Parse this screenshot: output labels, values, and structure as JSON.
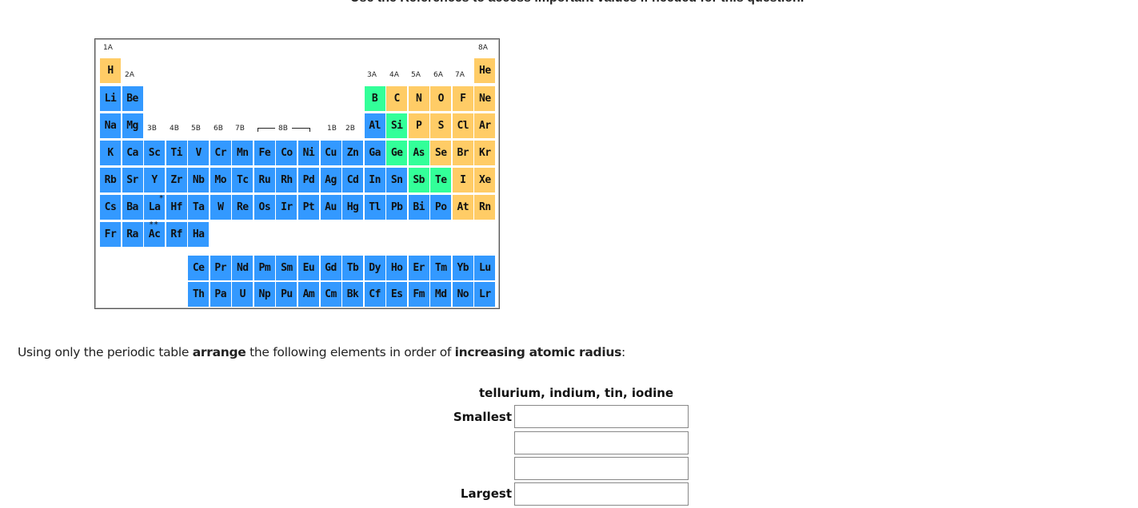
{
  "header": {
    "note": "Use the References to access important values if needed for this question."
  },
  "periodic_table": {
    "legend_colors": {
      "metal": "#3399ff",
      "nonmetal": "#ffcc66",
      "metalloid": "#33ff99"
    },
    "group_labels": {
      "g1": "1A",
      "g2": "2A",
      "g3": "3B",
      "g4": "4B",
      "g5": "5B",
      "g6": "6B",
      "g7": "7B",
      "g8": "8B",
      "g11": "1B",
      "g12": "2B",
      "g13": "3A",
      "g14": "4A",
      "g15": "5A",
      "g16": "6A",
      "g17": "7A",
      "g18": "8A"
    },
    "elements": [
      {
        "symbol": "H",
        "row": 1,
        "col": 1,
        "type": "nonmetal"
      },
      {
        "symbol": "He",
        "row": 1,
        "col": 18,
        "type": "nonmetal"
      },
      {
        "symbol": "Li",
        "row": 2,
        "col": 1,
        "type": "metal"
      },
      {
        "symbol": "Be",
        "row": 2,
        "col": 2,
        "type": "metal"
      },
      {
        "symbol": "B",
        "row": 2,
        "col": 13,
        "type": "metalloid"
      },
      {
        "symbol": "C",
        "row": 2,
        "col": 14,
        "type": "nonmetal"
      },
      {
        "symbol": "N",
        "row": 2,
        "col": 15,
        "type": "nonmetal"
      },
      {
        "symbol": "O",
        "row": 2,
        "col": 16,
        "type": "nonmetal"
      },
      {
        "symbol": "F",
        "row": 2,
        "col": 17,
        "type": "nonmetal"
      },
      {
        "symbol": "Ne",
        "row": 2,
        "col": 18,
        "type": "nonmetal"
      },
      {
        "symbol": "Na",
        "row": 3,
        "col": 1,
        "type": "metal"
      },
      {
        "symbol": "Mg",
        "row": 3,
        "col": 2,
        "type": "metal"
      },
      {
        "symbol": "Al",
        "row": 3,
        "col": 13,
        "type": "metal"
      },
      {
        "symbol": "Si",
        "row": 3,
        "col": 14,
        "type": "metalloid"
      },
      {
        "symbol": "P",
        "row": 3,
        "col": 15,
        "type": "nonmetal"
      },
      {
        "symbol": "S",
        "row": 3,
        "col": 16,
        "type": "nonmetal"
      },
      {
        "symbol": "Cl",
        "row": 3,
        "col": 17,
        "type": "nonmetal"
      },
      {
        "symbol": "Ar",
        "row": 3,
        "col": 18,
        "type": "nonmetal"
      },
      {
        "symbol": "K",
        "row": 4,
        "col": 1,
        "type": "metal"
      },
      {
        "symbol": "Ca",
        "row": 4,
        "col": 2,
        "type": "metal"
      },
      {
        "symbol": "Sc",
        "row": 4,
        "col": 3,
        "type": "metal"
      },
      {
        "symbol": "Ti",
        "row": 4,
        "col": 4,
        "type": "metal"
      },
      {
        "symbol": "V",
        "row": 4,
        "col": 5,
        "type": "metal"
      },
      {
        "symbol": "Cr",
        "row": 4,
        "col": 6,
        "type": "metal"
      },
      {
        "symbol": "Mn",
        "row": 4,
        "col": 7,
        "type": "metal"
      },
      {
        "symbol": "Fe",
        "row": 4,
        "col": 8,
        "type": "metal"
      },
      {
        "symbol": "Co",
        "row": 4,
        "col": 9,
        "type": "metal"
      },
      {
        "symbol": "Ni",
        "row": 4,
        "col": 10,
        "type": "metal"
      },
      {
        "symbol": "Cu",
        "row": 4,
        "col": 11,
        "type": "metal"
      },
      {
        "symbol": "Zn",
        "row": 4,
        "col": 12,
        "type": "metal"
      },
      {
        "symbol": "Ga",
        "row": 4,
        "col": 13,
        "type": "metal"
      },
      {
        "symbol": "Ge",
        "row": 4,
        "col": 14,
        "type": "metalloid"
      },
      {
        "symbol": "As",
        "row": 4,
        "col": 15,
        "type": "metalloid"
      },
      {
        "symbol": "Se",
        "row": 4,
        "col": 16,
        "type": "nonmetal"
      },
      {
        "symbol": "Br",
        "row": 4,
        "col": 17,
        "type": "nonmetal"
      },
      {
        "symbol": "Kr",
        "row": 4,
        "col": 18,
        "type": "nonmetal"
      },
      {
        "symbol": "Rb",
        "row": 5,
        "col": 1,
        "type": "metal"
      },
      {
        "symbol": "Sr",
        "row": 5,
        "col": 2,
        "type": "metal"
      },
      {
        "symbol": "Y",
        "row": 5,
        "col": 3,
        "type": "metal"
      },
      {
        "symbol": "Zr",
        "row": 5,
        "col": 4,
        "type": "metal"
      },
      {
        "symbol": "Nb",
        "row": 5,
        "col": 5,
        "type": "metal"
      },
      {
        "symbol": "Mo",
        "row": 5,
        "col": 6,
        "type": "metal"
      },
      {
        "symbol": "Tc",
        "row": 5,
        "col": 7,
        "type": "metal"
      },
      {
        "symbol": "Ru",
        "row": 5,
        "col": 8,
        "type": "metal"
      },
      {
        "symbol": "Rh",
        "row": 5,
        "col": 9,
        "type": "metal"
      },
      {
        "symbol": "Pd",
        "row": 5,
        "col": 10,
        "type": "metal"
      },
      {
        "symbol": "Ag",
        "row": 5,
        "col": 11,
        "type": "metal"
      },
      {
        "symbol": "Cd",
        "row": 5,
        "col": 12,
        "type": "metal"
      },
      {
        "symbol": "In",
        "row": 5,
        "col": 13,
        "type": "metal"
      },
      {
        "symbol": "Sn",
        "row": 5,
        "col": 14,
        "type": "metal"
      },
      {
        "symbol": "Sb",
        "row": 5,
        "col": 15,
        "type": "metalloid"
      },
      {
        "symbol": "Te",
        "row": 5,
        "col": 16,
        "type": "metalloid"
      },
      {
        "symbol": "I",
        "row": 5,
        "col": 17,
        "type": "nonmetal"
      },
      {
        "symbol": "Xe",
        "row": 5,
        "col": 18,
        "type": "nonmetal"
      },
      {
        "symbol": "Cs",
        "row": 6,
        "col": 1,
        "type": "metal"
      },
      {
        "symbol": "Ba",
        "row": 6,
        "col": 2,
        "type": "metal"
      },
      {
        "symbol": "La",
        "row": 6,
        "col": 3,
        "type": "metal",
        "mark": "*"
      },
      {
        "symbol": "Hf",
        "row": 6,
        "col": 4,
        "type": "metal"
      },
      {
        "symbol": "Ta",
        "row": 6,
        "col": 5,
        "type": "metal"
      },
      {
        "symbol": "W",
        "row": 6,
        "col": 6,
        "type": "metal"
      },
      {
        "symbol": "Re",
        "row": 6,
        "col": 7,
        "type": "metal"
      },
      {
        "symbol": "Os",
        "row": 6,
        "col": 8,
        "type": "metal"
      },
      {
        "symbol": "Ir",
        "row": 6,
        "col": 9,
        "type": "metal"
      },
      {
        "symbol": "Pt",
        "row": 6,
        "col": 10,
        "type": "metal"
      },
      {
        "symbol": "Au",
        "row": 6,
        "col": 11,
        "type": "metal"
      },
      {
        "symbol": "Hg",
        "row": 6,
        "col": 12,
        "type": "metal"
      },
      {
        "symbol": "Tl",
        "row": 6,
        "col": 13,
        "type": "metal"
      },
      {
        "symbol": "Pb",
        "row": 6,
        "col": 14,
        "type": "metal"
      },
      {
        "symbol": "Bi",
        "row": 6,
        "col": 15,
        "type": "metal"
      },
      {
        "symbol": "Po",
        "row": 6,
        "col": 16,
        "type": "metal"
      },
      {
        "symbol": "At",
        "row": 6,
        "col": 17,
        "type": "nonmetal"
      },
      {
        "symbol": "Rn",
        "row": 6,
        "col": 18,
        "type": "nonmetal"
      },
      {
        "symbol": "Fr",
        "row": 7,
        "col": 1,
        "type": "metal"
      },
      {
        "symbol": "Ra",
        "row": 7,
        "col": 2,
        "type": "metal"
      },
      {
        "symbol": "Ac",
        "row": 7,
        "col": 3,
        "type": "metal",
        "mark": "**"
      },
      {
        "symbol": "Rf",
        "row": 7,
        "col": 4,
        "type": "metal"
      },
      {
        "symbol": "Ha",
        "row": 7,
        "col": 5,
        "type": "metal"
      },
      {
        "symbol": "Ce",
        "row": 8,
        "col": 5,
        "type": "metal"
      },
      {
        "symbol": "Pr",
        "row": 8,
        "col": 6,
        "type": "metal"
      },
      {
        "symbol": "Nd",
        "row": 8,
        "col": 7,
        "type": "metal"
      },
      {
        "symbol": "Pm",
        "row": 8,
        "col": 8,
        "type": "metal"
      },
      {
        "symbol": "Sm",
        "row": 8,
        "col": 9,
        "type": "metal"
      },
      {
        "symbol": "Eu",
        "row": 8,
        "col": 10,
        "type": "metal"
      },
      {
        "symbol": "Gd",
        "row": 8,
        "col": 11,
        "type": "metal"
      },
      {
        "symbol": "Tb",
        "row": 8,
        "col": 12,
        "type": "metal"
      },
      {
        "symbol": "Dy",
        "row": 8,
        "col": 13,
        "type": "metal"
      },
      {
        "symbol": "Ho",
        "row": 8,
        "col": 14,
        "type": "metal"
      },
      {
        "symbol": "Er",
        "row": 8,
        "col": 15,
        "type": "metal"
      },
      {
        "symbol": "Tm",
        "row": 8,
        "col": 16,
        "type": "metal"
      },
      {
        "symbol": "Yb",
        "row": 8,
        "col": 17,
        "type": "metal"
      },
      {
        "symbol": "Lu",
        "row": 8,
        "col": 18,
        "type": "metal"
      },
      {
        "symbol": "Th",
        "row": 9,
        "col": 5,
        "type": "metal"
      },
      {
        "symbol": "Pa",
        "row": 9,
        "col": 6,
        "type": "metal"
      },
      {
        "symbol": "U",
        "row": 9,
        "col": 7,
        "type": "metal"
      },
      {
        "symbol": "Np",
        "row": 9,
        "col": 8,
        "type": "metal"
      },
      {
        "symbol": "Pu",
        "row": 9,
        "col": 9,
        "type": "metal"
      },
      {
        "symbol": "Am",
        "row": 9,
        "col": 10,
        "type": "metal"
      },
      {
        "symbol": "Cm",
        "row": 9,
        "col": 11,
        "type": "metal"
      },
      {
        "symbol": "Bk",
        "row": 9,
        "col": 12,
        "type": "metal"
      },
      {
        "symbol": "Cf",
        "row": 9,
        "col": 13,
        "type": "metal"
      },
      {
        "symbol": "Es",
        "row": 9,
        "col": 14,
        "type": "metal"
      },
      {
        "symbol": "Fm",
        "row": 9,
        "col": 15,
        "type": "metal"
      },
      {
        "symbol": "Md",
        "row": 9,
        "col": 16,
        "type": "metal"
      },
      {
        "symbol": "No",
        "row": 9,
        "col": 17,
        "type": "metal"
      },
      {
        "symbol": "Lr",
        "row": 9,
        "col": 18,
        "type": "metal"
      }
    ]
  },
  "question": {
    "part1": "Using only the periodic table ",
    "bold1": "arrange",
    "part2": " the following elements in order of ",
    "bold2": "increasing atomic radius",
    "part3": ":"
  },
  "element_list": "tellurium, indium, tin, iodine",
  "answers": {
    "smallest_label": "Smallest",
    "largest_label": "Largest",
    "slots": [
      {
        "value": ""
      },
      {
        "value": ""
      },
      {
        "value": ""
      },
      {
        "value": ""
      }
    ]
  }
}
